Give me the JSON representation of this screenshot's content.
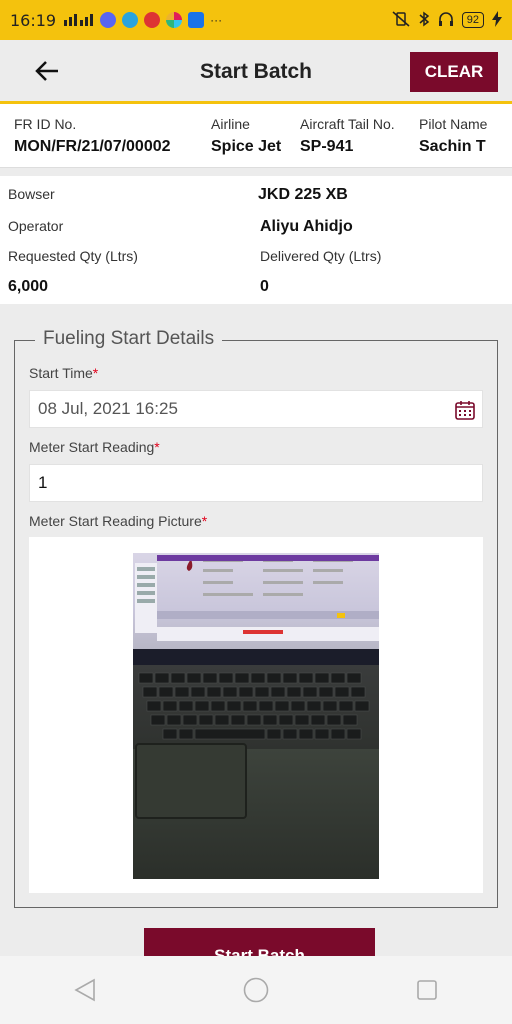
{
  "status_bar": {
    "time": "16:19",
    "battery": "92"
  },
  "header": {
    "title": "Start Batch",
    "clear_label": "CLEAR"
  },
  "summary": {
    "fr_id_label": "FR ID No.",
    "fr_id_value": "MON/FR/21/07/00002",
    "airline_label": "Airline",
    "airline_value": "Spice Jet",
    "tail_label": "Aircraft Tail No.",
    "tail_value": "SP-941",
    "pilot_label": "Pilot Name",
    "pilot_value": "Sachin T"
  },
  "info": {
    "bowser_label": "Bowser",
    "bowser_value": "JKD 225 XB",
    "operator_label": "Operator",
    "operator_value": "Aliyu Ahidjo",
    "requested_label": "Requested Qty (Ltrs)",
    "requested_value": "6,000",
    "delivered_label": "Delivered Qty (Ltrs)",
    "delivered_value": "0"
  },
  "fueling": {
    "legend": "Fueling Start Details",
    "start_time_label": "Start Time",
    "start_time_value": "08 Jul, 2021 16:25",
    "meter_reading_label": "Meter Start Reading",
    "meter_reading_value": "1",
    "meter_picture_label": "Meter Start Reading Picture",
    "required_marker": "*"
  },
  "actions": {
    "start_batch_label": "Start Batch"
  },
  "colors": {
    "accent_yellow": "#f4c20d",
    "primary_maroon": "#7a0a2b",
    "required_red": "#e0001b"
  }
}
